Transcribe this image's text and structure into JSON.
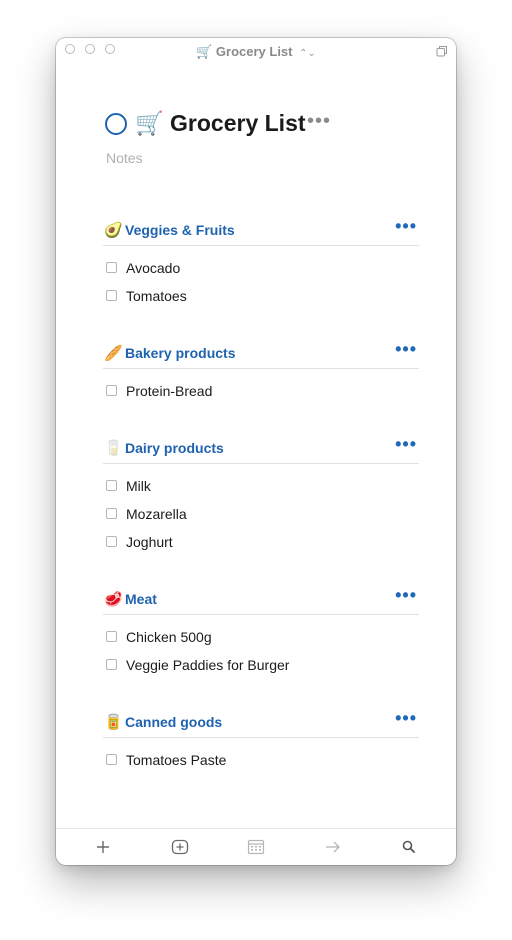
{
  "window": {
    "title_icon": "🛒",
    "title": "Grocery List",
    "title_chevron": "⌃⌄"
  },
  "project": {
    "title": "🛒 Grocery List",
    "more": "•••",
    "notes_placeholder": "Notes"
  },
  "sections": [
    {
      "emoji": "🥑",
      "title": "Veggies & Fruits",
      "more": "•••",
      "items": [
        "Avocado",
        "Tomatoes"
      ]
    },
    {
      "emoji": "🥖",
      "title": "Bakery products",
      "more": "•••",
      "items": [
        "Protein-Bread"
      ]
    },
    {
      "emoji": "🥛",
      "title": "Dairy products",
      "more": "•••",
      "items": [
        "Milk",
        "Mozarella",
        "Joghurt"
      ]
    },
    {
      "emoji": "🥩",
      "title": "Meat",
      "more": "•••",
      "items": [
        "Chicken 500g",
        "Veggie Paddies for Burger"
      ]
    },
    {
      "emoji": "🥫",
      "title": "Canned goods",
      "more": "•••",
      "items": [
        "Tomatoes Paste"
      ]
    }
  ],
  "toolbar": {
    "icons": [
      "plus-icon",
      "add-checklist-icon",
      "calendar-icon",
      "arrow-right-icon",
      "search-icon"
    ]
  },
  "colors": {
    "accent": "#1f63b0",
    "text": "#1b1b1b",
    "muted": "#b0b0b0"
  }
}
